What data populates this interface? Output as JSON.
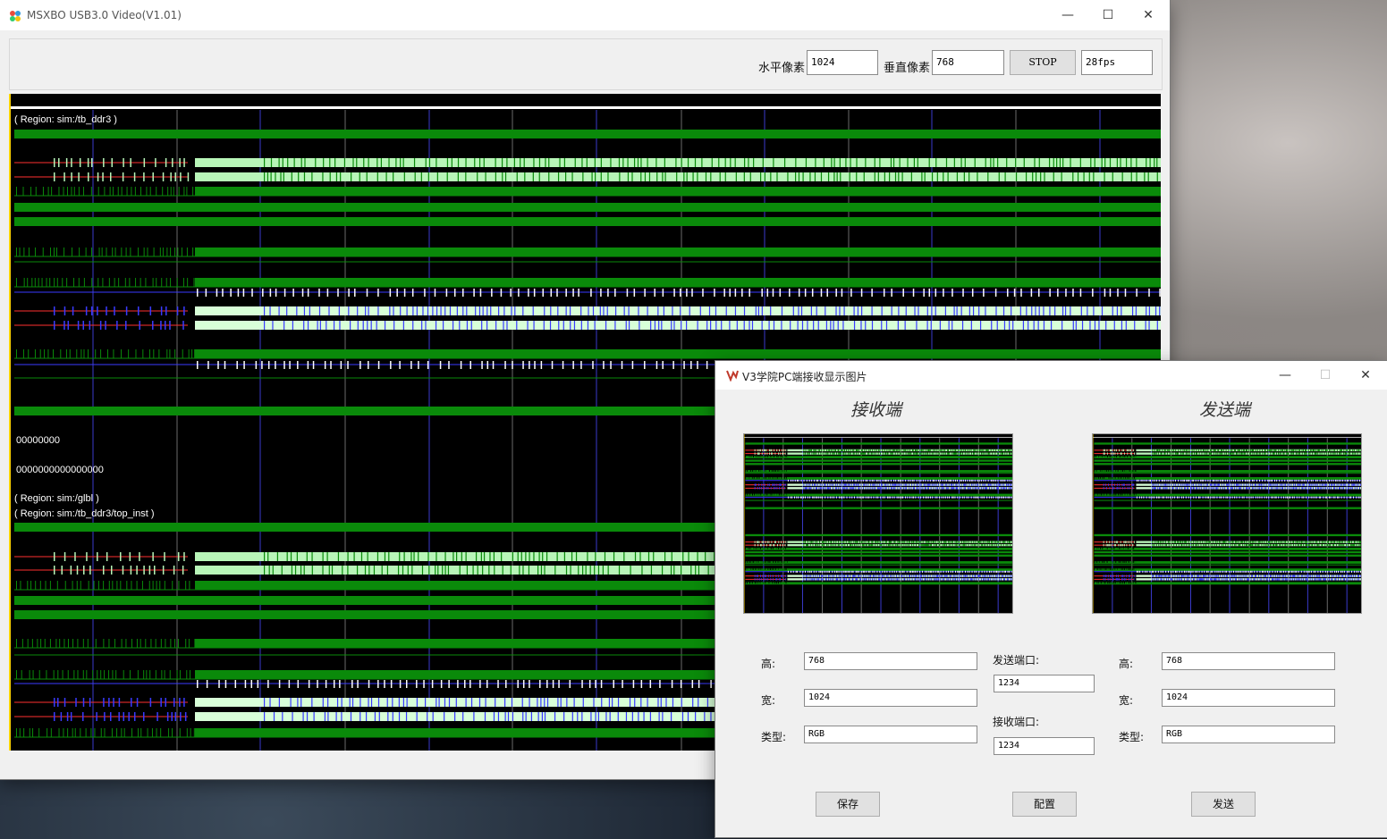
{
  "main_window": {
    "title": "MSXBO USB3.0 Video(V1.01)",
    "controls": {
      "minimize": "—",
      "maximize": "☐",
      "close": "✕"
    },
    "toolbar": {
      "h_pixels_label": "水平像素",
      "h_pixels_value": "1024",
      "v_pixels_label": "垂直像素",
      "v_pixels_value": "768",
      "stop_label": "STOP",
      "fps_value": "28fps"
    },
    "waveform": {
      "region1": "( Region: sim:/tb_ddr3 )",
      "value1": "00000000",
      "value2": "0000000000000000",
      "region2": "( Region: sim:/glbl )",
      "region3": "( Region: sim:/tb_ddr3/top_inst )"
    }
  },
  "dialog": {
    "title": "V3学院PC端接收显示图片",
    "controls": {
      "minimize": "—",
      "maximize": "☐",
      "close": "✕"
    },
    "receive_heading": "接收端",
    "send_heading": "发送端",
    "left": {
      "height_label": "高:",
      "height_value": "768",
      "width_label": "宽:",
      "width_value": "1024",
      "type_label": "类型:",
      "type_value": "RGB"
    },
    "middle": {
      "send_port_label": "发送端口:",
      "send_port_value": "1234",
      "recv_port_label": "接收端口:",
      "recv_port_value": "1234"
    },
    "right": {
      "height_label": "高:",
      "height_value": "768",
      "width_label": "宽:",
      "width_value": "1024",
      "type_label": "类型:",
      "type_value": "RGB"
    },
    "buttons": {
      "save": "保存",
      "config": "配置",
      "send": "发送"
    }
  },
  "colors": {
    "waveform_bg": "#000000",
    "signal_green": "#0a8a0a",
    "signal_lightgreen": "#b8f5b8",
    "signal_blue": "#3a3aff",
    "signal_red": "#ff3030",
    "cursor_yellow": "#ffd400"
  },
  "icons": {
    "main_app": "msxbo-logo-icon",
    "dialog_app": "v3-logo-icon"
  }
}
